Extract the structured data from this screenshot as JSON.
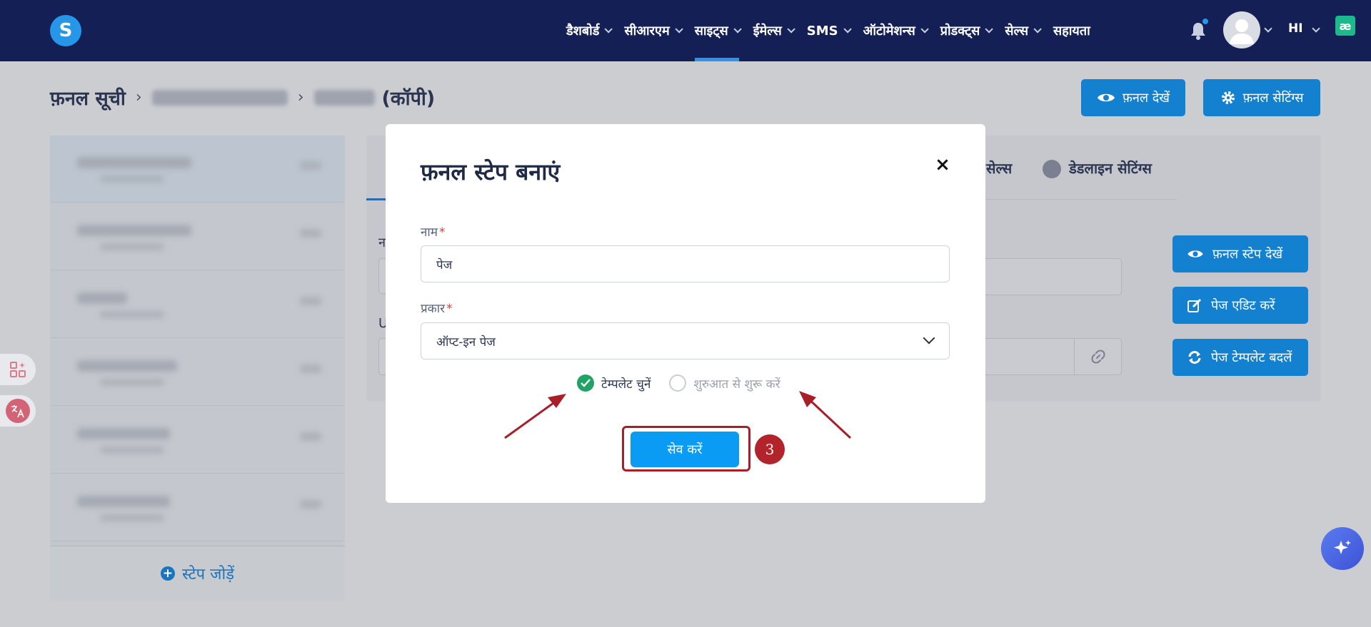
{
  "app": {
    "logo_letter": "S"
  },
  "nav": {
    "items": [
      {
        "label": "डैशबोर्ड",
        "has_dropdown": true,
        "active": false
      },
      {
        "label": "सीआरएम",
        "has_dropdown": true,
        "active": false
      },
      {
        "label": "साइट्स",
        "has_dropdown": true,
        "active": true
      },
      {
        "label": "ईमेल्स",
        "has_dropdown": true,
        "active": false
      },
      {
        "label": "SMS",
        "has_dropdown": true,
        "active": false
      },
      {
        "label": "ऑटोमेशन्स",
        "has_dropdown": true,
        "active": false
      },
      {
        "label": "प्रोडक्ट्स",
        "has_dropdown": true,
        "active": false
      },
      {
        "label": "सेल्स",
        "has_dropdown": true,
        "active": false
      },
      {
        "label": "सहायता",
        "has_dropdown": false,
        "active": false
      }
    ],
    "language": "HI",
    "extension_icon_glyph": "æ"
  },
  "breadcrumb": {
    "root": "फ़नल सूची",
    "current_suffix": "(कॉपी)"
  },
  "header_buttons": {
    "view_funnel": "फ़नल देखें",
    "funnel_settings": "फ़नल सेटिंग्स"
  },
  "background": {
    "tab_sales": "सेल्स",
    "tab_deadline": "डेडलाइन सेटिंग्स",
    "field_label_1": "न",
    "field_label_2": "U",
    "side_buttons": {
      "view_step": "फ़नल स्टेप देखें",
      "edit_page": "पेज एडिट करें",
      "change_template": "पेज टेम्पलेट बदलें"
    },
    "add_step": "स्टेप जोड़ें"
  },
  "modal": {
    "title": "फ़नल स्टेप बनाएं",
    "close_glyph": "×",
    "name_label": "नाम",
    "name_value": "पेज",
    "type_label": "प्रकार",
    "type_value": "ऑप्ट-इन पेज",
    "required_mark": "*",
    "radio_template": "टेम्पलेट चुनें",
    "radio_scratch": "शुरुआत से शुरू करें",
    "radio_selected": "template",
    "save_button": "सेव करें"
  },
  "annotation": {
    "step_number": "3"
  },
  "colors": {
    "nav_bg": "#142055",
    "primary": "#1480d0",
    "save_blue": "#0a9bf5",
    "annotation_red": "#a81f2a",
    "radio_green": "#21a366"
  }
}
